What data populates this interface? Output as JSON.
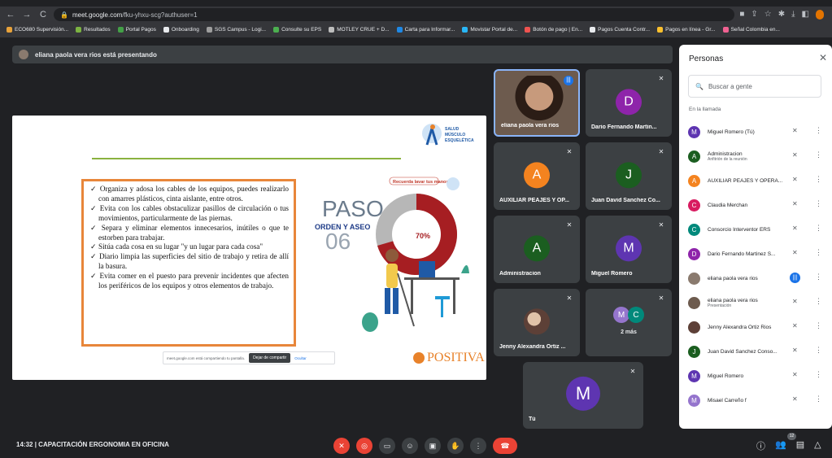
{
  "browser": {
    "url_host": "meet.google.com",
    "url_path": "/fku-yhxu-scg?authuser=1",
    "bookmarks": [
      {
        "label": "ECO680 Supervisión...",
        "color": "#e8a23a"
      },
      {
        "label": "Resultados",
        "color": "#7cb342"
      },
      {
        "label": "Portal Pagos",
        "color": "#43a047"
      },
      {
        "label": "Onboarding",
        "color": "#e8eaed"
      },
      {
        "label": "SGS Campus - Logi...",
        "color": "#9e9e9e"
      },
      {
        "label": "Consulte su EPS",
        "color": "#4caf50"
      },
      {
        "label": "MOTLEY CRUE + D...",
        "color": "#bdbdbd"
      },
      {
        "label": "Carta para Informar...",
        "color": "#1e88e5"
      },
      {
        "label": "Movistar Portal de...",
        "color": "#29b6f6"
      },
      {
        "label": "Botón de pago | En...",
        "color": "#ef5350"
      },
      {
        "label": "Pagos Cuenta Contr...",
        "color": "#e8eaed"
      },
      {
        "label": "Pagos en línea - Gr...",
        "color": "#fbc02d"
      },
      {
        "label": "Señal Colombia en...",
        "color": "#f06292"
      }
    ]
  },
  "banner": {
    "text": "eliana paola vera rios está presentando"
  },
  "slide": {
    "bullets": [
      "✓ Organiza y adosa los cables de los equipos, puedes realizarlo con amarres plásticos, cinta aislante, entre otros.",
      "✓ Evita con los cables obstaculizar pasillos de circulación o tus movimientos, particularmente de las piernas.",
      "✓ Separa y eliminar elementos innecesarios, inútiles o que te estorben para trabajar.",
      "✓ Sitúa cada cosa en su lugar \"y un lugar para cada cosa\"",
      "✓ Diario limpia las superficies del sitio de trabajo y retira de allí la basura.",
      "✓ Evita comer en el puesto para prevenir incidentes que afecten los periféricos de los equipos y otros elementos de trabajo."
    ],
    "paso_word": "PASO",
    "paso_number": "06",
    "paso_label": "ORDEN Y ASEO",
    "percent": "70%",
    "reminder": "Recuerda lavar tus manos",
    "logo_small": "SALUD MÚSCULO ESQUELÉTICA",
    "positiva": "POSITIVA",
    "share_text": "meet.google.com está compartiendo tu pantalla.",
    "stop_share": "Dejar de compartir",
    "hide": "Ocultar"
  },
  "tiles": [
    {
      "name": "eliana paola vera rios",
      "type": "camera"
    },
    {
      "name": "Dario Fernando Martin...",
      "initial": "D",
      "color": "#8e24aa"
    },
    {
      "name": "AUXILIAR PEAJES Y OP...",
      "initial": "A",
      "color": "#f4831f"
    },
    {
      "name": "Juan David Sanchez Co...",
      "initial": "J",
      "color": "#1b5e20"
    },
    {
      "name": "Administracion",
      "initial": "A",
      "color": "#1b5e20"
    },
    {
      "name": "Miguel Romero",
      "initial": "M",
      "color": "#5e35b1"
    },
    {
      "name": "Jenny Alexandra Ortiz ...",
      "type": "photo"
    },
    {
      "name": "2 más",
      "initials": [
        "M",
        "C"
      ]
    },
    {
      "name": "Tú",
      "initial": "M",
      "color": "#5e35b1"
    }
  ],
  "people": {
    "title": "Personas",
    "search_placeholder": "Buscar a gente",
    "section": "En la llamada",
    "list": [
      {
        "name": "Miguel Romero (Tú)",
        "initial": "M",
        "color": "#5e35b1",
        "sub": ""
      },
      {
        "name": "Administracion",
        "initial": "A",
        "color": "#1b5e20",
        "sub": "Anfitrión de la reunión"
      },
      {
        "name": "AUXILIAR PEAJES Y OPERA...",
        "initial": "A",
        "color": "#f4831f",
        "sub": ""
      },
      {
        "name": "Claudia Merchan",
        "initial": "C",
        "color": "#d81b60",
        "sub": ""
      },
      {
        "name": "Consorcio Interventor ERS",
        "initial": "C",
        "color": "#00897b",
        "sub": ""
      },
      {
        "name": "Dario Fernando Martinez S...",
        "initial": "D",
        "color": "#8e24aa",
        "sub": ""
      },
      {
        "name": "eliana paola vera rios",
        "initial": "",
        "color": "#8a7a6e",
        "sub": "",
        "speaking": true
      },
      {
        "name": "eliana paola vera rios",
        "initial": "",
        "color": "#6d5b4e",
        "sub": "Presentación"
      },
      {
        "name": "Jenny Alexandra Ortiz Rios",
        "initial": "",
        "color": "#5d4037",
        "sub": ""
      },
      {
        "name": "Juan David Sanchez Conso...",
        "initial": "J",
        "color": "#1b5e20",
        "sub": ""
      },
      {
        "name": "Miguel Romero",
        "initial": "M",
        "color": "#5e35b1",
        "sub": ""
      },
      {
        "name": "Misael Carreño f",
        "initial": "M",
        "color": "#9575cd",
        "sub": ""
      }
    ]
  },
  "bottom": {
    "time": "14:32",
    "meeting": "CAPACITACIÓN ERGONOMIA EN OFICINA",
    "people_count": "12"
  }
}
